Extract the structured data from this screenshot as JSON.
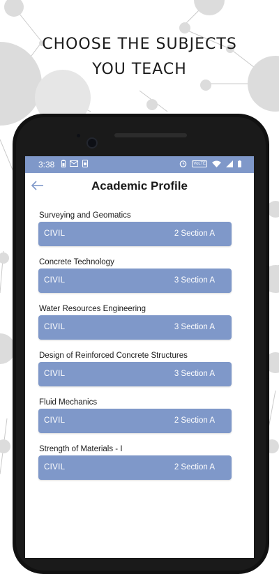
{
  "promo": {
    "headline_line1": "CHOOSE THE SUBJECTS",
    "headline_line2": "YOU TEACH"
  },
  "status_bar": {
    "time": "3:38",
    "network_badge": "VoLTE"
  },
  "app_bar": {
    "title": "Academic Profile"
  },
  "subjects": [
    {
      "name": "Surveying and Geomatics",
      "department": "CIVIL",
      "section": "2 Section A"
    },
    {
      "name": "Concrete Technology",
      "department": "CIVIL",
      "section": "3 Section A"
    },
    {
      "name": "Water Resources Engineering",
      "department": "CIVIL",
      "section": "3 Section A"
    },
    {
      "name": "Design of Reinforced Concrete Structures",
      "department": "CIVIL",
      "section": "3 Section A"
    },
    {
      "name": "Fluid Mechanics",
      "department": "CIVIL",
      "section": "2 Section A"
    },
    {
      "name": "Strength of Materials - I",
      "department": "CIVIL",
      "section": "2 Section A"
    }
  ],
  "colors": {
    "accent": "#7f98c9",
    "phone_body": "#111111",
    "text": "#1a1a1a"
  },
  "icons": [
    "battery-icon",
    "mail-icon",
    "sim-icon",
    "alarm-icon",
    "wifi-icon",
    "signal-icon",
    "back-arrow-icon"
  ]
}
